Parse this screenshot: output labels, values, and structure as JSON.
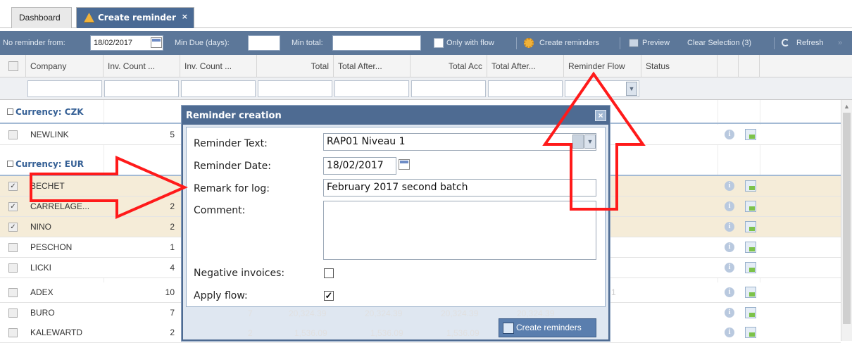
{
  "tabs": [
    {
      "label": "Dashboard"
    },
    {
      "label": "Create reminder",
      "close": "×"
    }
  ],
  "toolbar": {
    "no_reminder_label": "No reminder from:",
    "no_reminder_value": "18/02/2017",
    "min_due_label": "Min Due (days):",
    "min_due_value": "",
    "min_total_label": "Min total:",
    "min_total_value": "",
    "only_with_flow": "Only with flow",
    "create_reminders": "Create reminders",
    "preview": "Preview",
    "clear_selection": "Clear Selection (3)",
    "refresh": "Refresh",
    "overflow": "»"
  },
  "columns": [
    "Company",
    "Inv. Count ...",
    "Inv. Count ...",
    "Total",
    "Total After...",
    "Total Acc",
    "Total After...",
    "Reminder Flow",
    "Status"
  ],
  "groups": [
    {
      "label": "Currency: CZK"
    },
    {
      "label": "Currency: EUR"
    }
  ],
  "rows": [
    {
      "company": "NEWLINK",
      "count": "5",
      "checked": false
    },
    {
      "company": "BECHET",
      "count": "",
      "checked": true
    },
    {
      "company": "CARRELAGE...",
      "count": "2",
      "checked": true
    },
    {
      "company": "NINO",
      "count": "2",
      "checked": true
    },
    {
      "company": "PESCHON",
      "count": "1",
      "checked": false
    },
    {
      "company": "LICKI",
      "count": "4",
      "checked": false
    },
    {
      "company": "ADEX",
      "count": "10",
      "checked": false
    },
    {
      "company": "BURO",
      "count": "7",
      "checked": false
    },
    {
      "company": "KALEWARTD",
      "count": "2",
      "checked": false
    }
  ],
  "background_values": {
    "buro": [
      "7",
      "20,324.39",
      "20,324.39",
      "20,324.39",
      "20,324.39"
    ],
    "kalewartd": [
      "2",
      "1,536.09",
      "1,536.09",
      "1,536.09",
      "1,536.09"
    ],
    "adex_flow": "1"
  },
  "dialog": {
    "title": "Reminder creation",
    "reminder_text_label": "Reminder Text:",
    "reminder_text_value": "RAP01 Niveau 1",
    "reminder_date_label": "Reminder Date:",
    "reminder_date_value": "18/02/2017",
    "remark_label": "Remark for log:",
    "remark_value": "February 2017 second batch",
    "comment_label": "Comment:",
    "comment_value": "",
    "negative_label": "Negative invoices:",
    "negative_checked": false,
    "apply_flow_label": "Apply flow:",
    "apply_flow_checked": true,
    "create_button": "Create reminders"
  },
  "colors": {
    "toolbar": "#5c7799",
    "active_tab": "#4a6a94",
    "group_text": "#345f95",
    "selected_row": "#f5ecd8",
    "annotation_arrow": "#ff1a1a"
  },
  "icons": [
    "warning-icon",
    "close-icon",
    "calendar-icon",
    "gear-icon",
    "printer-icon",
    "refresh-icon",
    "info-icon",
    "document-icon",
    "chevron-down-icon"
  ]
}
